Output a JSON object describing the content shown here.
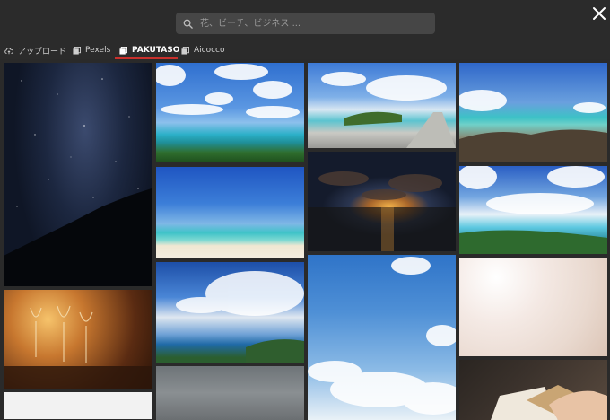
{
  "search": {
    "placeholder": "花、ビーチ、ビジネス ..."
  },
  "tabs": [
    {
      "label": "アップロード",
      "icon": "cloud-upload-icon",
      "active": false
    },
    {
      "label": "Pexels",
      "icon": "image-stack-icon",
      "active": false
    },
    {
      "label": "PAKUTASO",
      "icon": "image-stack-icon",
      "active": true
    },
    {
      "label": "Aicocco",
      "icon": "image-stack-icon",
      "active": false
    }
  ],
  "colors": {
    "accent": "#c9302c",
    "background": "#2b2b2b",
    "search_bg": "#464646"
  },
  "icons": {
    "search": "search-icon",
    "close": "close-icon"
  }
}
